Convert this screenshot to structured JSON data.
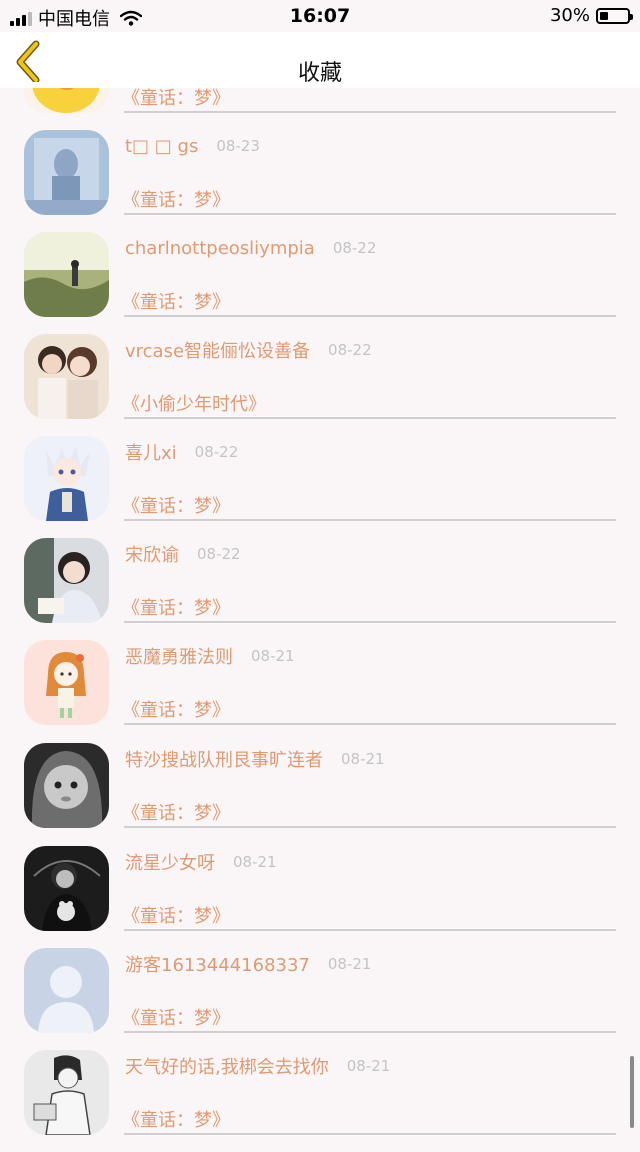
{
  "status_bar": {
    "carrier": "中国电信",
    "time": "16:07",
    "battery_percent": "30%",
    "battery_level": 0.3
  },
  "nav": {
    "title": "收藏",
    "back_icon": "chevron-left-icon",
    "accent": "#f0c419"
  },
  "colors": {
    "name": "#e09a72",
    "story": "#e09a72",
    "date": "#c4c4c4",
    "divider": "#cfcfcf"
  },
  "items": [
    {
      "name": "",
      "date": "",
      "story": "《童话：梦》",
      "avatar": "yellow-bird-avatar"
    },
    {
      "name": "t□ □ gs",
      "date": "08-23",
      "story": "《童话：梦》",
      "avatar": "blue-photo-avatar"
    },
    {
      "name": "charlnottpeosliympia",
      "date": "08-22",
      "story": "《童话：梦》",
      "avatar": "grass-field-avatar"
    },
    {
      "name": "vrcase智能俪忪设善备",
      "date": "08-22",
      "story": "《小偷少年时代》",
      "avatar": "couple-avatar"
    },
    {
      "name": "喜儿xi",
      "date": "08-22",
      "story": "《童话：梦》",
      "avatar": "anime-boy-avatar"
    },
    {
      "name": "宋欣谕",
      "date": "08-22",
      "story": "《童话：梦》",
      "avatar": "girl-photo-avatar"
    },
    {
      "name": "恶魔勇雅法则",
      "date": "08-21",
      "story": "《童话：梦》",
      "avatar": "cartoon-girl-avatar"
    },
    {
      "name": "特沙搜战队刑艮事旷连者",
      "date": "08-21",
      "story": "《童话：梦》",
      "avatar": "baby-hood-avatar"
    },
    {
      "name": "流星少女呀",
      "date": "08-21",
      "story": "《童话：梦》",
      "avatar": "bw-girl-avatar"
    },
    {
      "name": "游客1613444168337",
      "date": "08-21",
      "story": "《童话：梦》",
      "avatar": "default-user-avatar"
    },
    {
      "name": "天气好的话,我梆会去找你",
      "date": "08-21",
      "story": "《童话：梦》",
      "avatar": "sketch-avatar"
    }
  ]
}
